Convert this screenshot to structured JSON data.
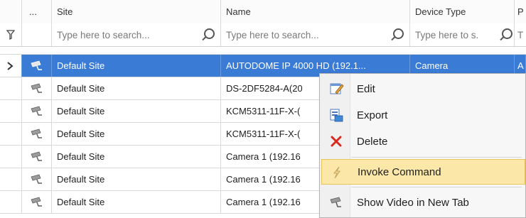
{
  "columns": [
    "...",
    "Site",
    "Name",
    "Device Type",
    "P"
  ],
  "filter": {
    "site_placeholder": "Type here to search...",
    "name_placeholder": "Type here to search...",
    "type_placeholder": "Type here to s.",
    "last_placeholder": "T"
  },
  "rows": [
    {
      "site": "Default Site",
      "name": "AUTODOME IP 4000 HD (192.1...",
      "type": "Camera",
      "extra": "A"
    },
    {
      "site": "Default Site",
      "name": "DS-2DF5284-A(20",
      "type": "",
      "extra": ""
    },
    {
      "site": "Default Site",
      "name": "KCM5311-11F-X-(",
      "type": "",
      "extra": ""
    },
    {
      "site": "Default Site",
      "name": "KCM5311-11F-X-(",
      "type": "",
      "extra": ""
    },
    {
      "site": "Default Site",
      "name": "Camera 1 (192.16",
      "type": "",
      "extra": ""
    },
    {
      "site": "Default Site",
      "name": "Camera 1 (192.16",
      "type": "",
      "extra": ""
    },
    {
      "site": "Default Site",
      "name": "Camera 1 (192.16",
      "type": "",
      "extra": ""
    }
  ],
  "context_menu": {
    "items": [
      {
        "label": "Edit",
        "icon": "edit-icon"
      },
      {
        "label": "Export",
        "icon": "export-icon"
      },
      {
        "label": "Delete",
        "icon": "delete-icon"
      },
      {
        "label": "Invoke Command",
        "icon": "lightning-icon"
      },
      {
        "label": "Show Video in New Tab",
        "icon": "camera-icon"
      }
    ]
  },
  "colors": {
    "selection": "#3a7bd5",
    "menu_highlight": "#fbe7a8"
  }
}
